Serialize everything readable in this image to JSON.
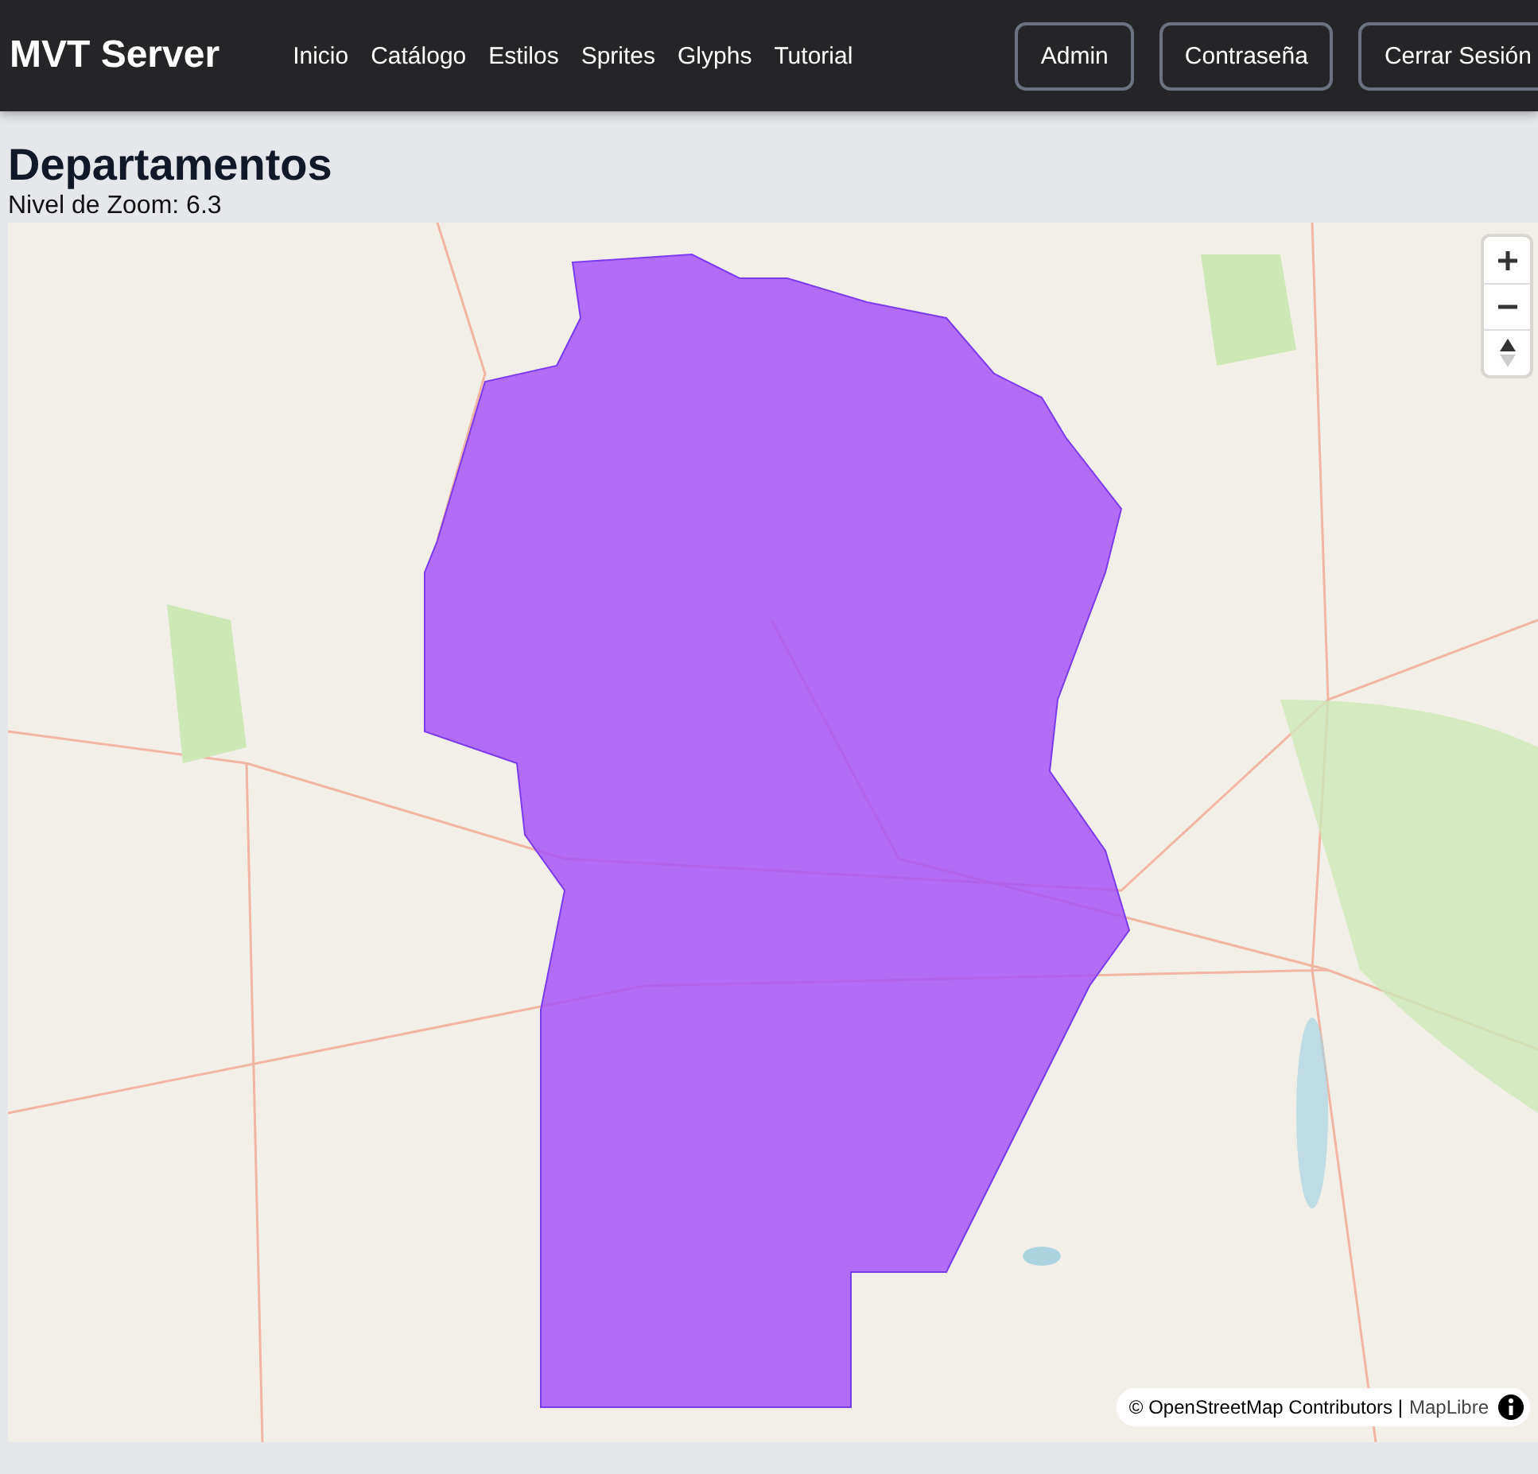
{
  "navbar": {
    "brand": "MVT Server",
    "links": [
      "Inicio",
      "Catálogo",
      "Estilos",
      "Sprites",
      "Glyphs",
      "Tutorial"
    ],
    "buttons": [
      "Admin",
      "Contraseña",
      "Cerrar Sesión"
    ]
  },
  "page": {
    "title": "Departamentos",
    "zoom_label": "Nivel de Zoom: 6.3"
  },
  "map": {
    "attribution": "© OpenStreetMap Contributors |",
    "attribution_link": "MapLibre"
  }
}
